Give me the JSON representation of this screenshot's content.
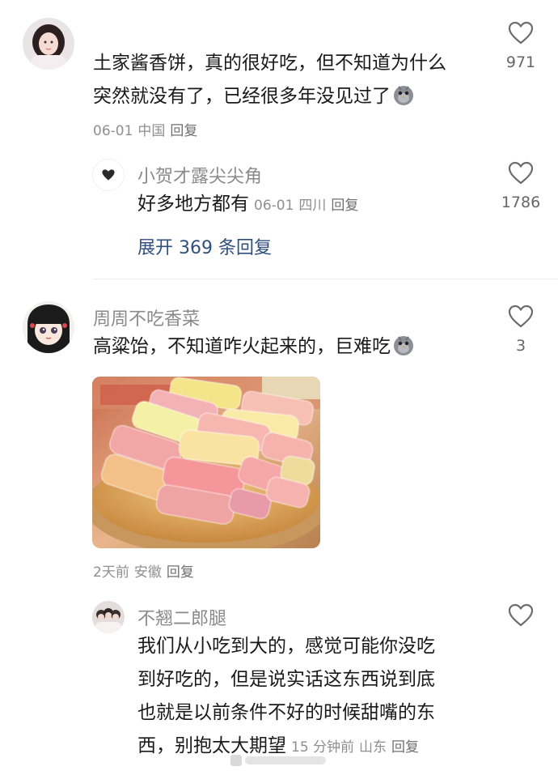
{
  "comments": [
    {
      "id": "c1",
      "content_lines": [
        "土家酱香饼，真的很好吃，但不知道为什么",
        "突然就没有了，已经很多年没见过了"
      ],
      "date": "06-01",
      "location": "中国",
      "reply_label": "回复",
      "likes": "971",
      "emoji": "pigeon-emoji",
      "replies": [
        {
          "username": "小贺才露尖尖角",
          "content": "好多地方都有",
          "date": "06-01",
          "location": "四川",
          "reply_label": "回复",
          "likes": "1786"
        }
      ],
      "expand_label": "展开 369 条回复"
    },
    {
      "id": "c2",
      "username": "周周不吃香菜",
      "content": "高粱饴，不知道咋火起来的，巨难吃",
      "emoji": "pigeon-emoji",
      "date": "2天前",
      "location": "安徽",
      "reply_label": "回复",
      "likes": "3",
      "image": "candy-photo",
      "replies": [
        {
          "username": "不翘二郎腿",
          "content_lines": [
            "我们从小吃到大的，感觉可能你没吃",
            "到好吃的，但是说实话这东西说到底",
            "也就是以前条件不好的时候甜嘴的东",
            "西，别抱太大期望"
          ],
          "date": "15 分钟前",
          "location": "山东",
          "reply_label": "回复"
        }
      ]
    }
  ],
  "colors": {
    "username": "#8a8a8a",
    "meta": "#8f8f8f",
    "expand": "#2f4f7f",
    "divider": "#ececec"
  }
}
